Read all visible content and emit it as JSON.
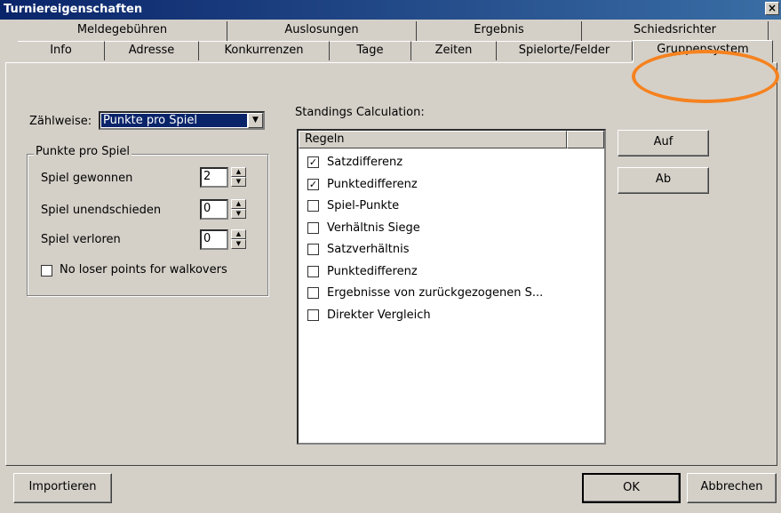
{
  "window": {
    "title": "Turniereigenschaften",
    "close_label": "×"
  },
  "tabs_row1": [
    "Meldegebühren",
    "Auslosungen",
    "Ergebnis",
    "Schiedsrichter"
  ],
  "tabs_row2": [
    "Info",
    "Adresse",
    "Konkurrenzen",
    "Tage",
    "Zeiten",
    "Spielorte/Felder",
    "Gruppensystem"
  ],
  "active_tab": "Gruppensystem",
  "scoring": {
    "label": "Zählweise:",
    "selected": "Punkte pro Spiel",
    "group_label": "Punkte pro Spiel",
    "fields": [
      {
        "label": "Spiel gewonnen",
        "value": "2"
      },
      {
        "label": "Spiel unendschieden",
        "value": "0"
      },
      {
        "label": "Spiel verloren",
        "value": "0"
      }
    ],
    "walkover": {
      "label": "No loser points for walkovers",
      "checked": false
    }
  },
  "standings": {
    "label": "Standings Calculation:",
    "column_header": "Regeln",
    "rules": [
      {
        "label": "Satzdifferenz",
        "checked": true
      },
      {
        "label": "Punktedifferenz",
        "checked": true
      },
      {
        "label": "Spiel-Punkte",
        "checked": false
      },
      {
        "label": "Verhältnis Siege",
        "checked": false
      },
      {
        "label": "Satzverhältnis",
        "checked": false
      },
      {
        "label": "Punktedifferenz",
        "checked": false
      },
      {
        "label": "Ergebnisse von zurückgezogenen S...",
        "checked": false
      },
      {
        "label": "Direkter Vergleich",
        "checked": false
      }
    ],
    "up_label": "Auf",
    "down_label": "Ab"
  },
  "footer": {
    "import_label": "Importieren",
    "ok_label": "OK",
    "cancel_label": "Abbrechen"
  },
  "colors": {
    "titlebar": "#0a246a",
    "highlight": "#f5821f",
    "selection": "#0a246a"
  }
}
